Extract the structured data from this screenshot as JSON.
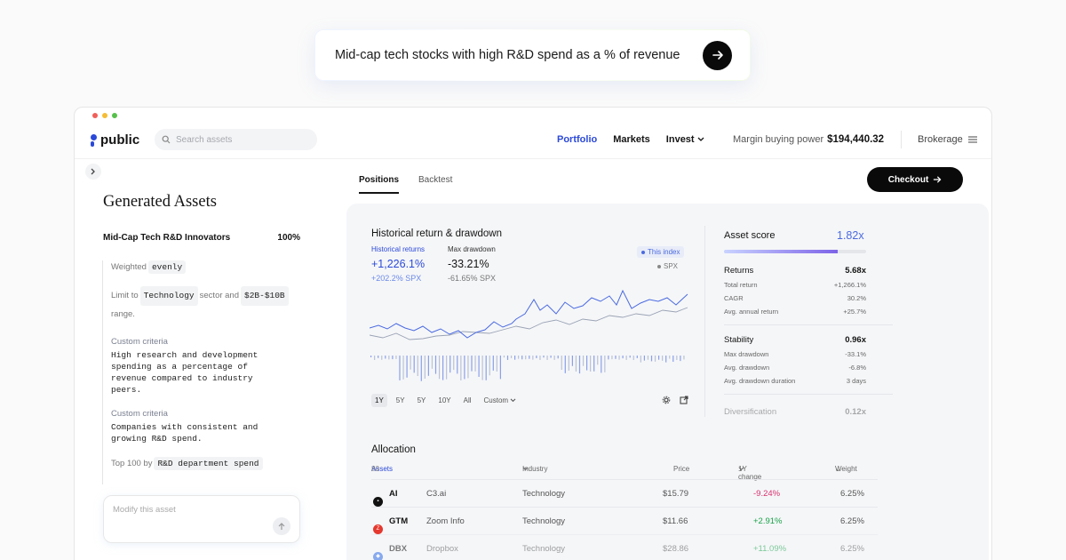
{
  "prompt": {
    "text": "Mid-cap tech stocks with high R&D spend as a % of revenue"
  },
  "window": {
    "dot_colors": [
      "#f0605a",
      "#f5bd35",
      "#56c04b"
    ]
  },
  "header": {
    "logo_text": "public",
    "search_placeholder": "Search assets",
    "nav": [
      "Portfolio",
      "Markets",
      "Invest"
    ],
    "margin_label": "Margin buying power",
    "margin_value": "$194,440.32",
    "brokerage": "Brokerage"
  },
  "sidebar": {
    "title": "Generated Assets",
    "asset_name": "Mid-Cap Tech R&D Innovators",
    "asset_pct": "100%",
    "criteria": {
      "weighted_prefix": "Weighted",
      "weighted_value": "evenly",
      "limit_prefix": "Limit to",
      "limit_sector": "Technology",
      "limit_mid": "sector and",
      "limit_range": "$2B-$10B",
      "limit_suffix": "range.",
      "custom1_label": "Custom criteria",
      "custom1_text": "High research and development spending as a percentage of revenue compared to industry peers.",
      "custom2_label": "Custom criteria",
      "custom2_text": "Companies with consistent and growing R&D spend.",
      "top_prefix": "Top 100 by",
      "top_value": "R&D department spend"
    },
    "modify_placeholder": "Modify this asset"
  },
  "tabs": [
    "Positions",
    "Backtest"
  ],
  "checkout_label": "Checkout",
  "history": {
    "title": "Historical return & drawdown",
    "ret_label": "Historical returns",
    "ret_value": "+1,226.1%",
    "ret_sub": "+202.2% SPX",
    "dd_label": "Max drawdown",
    "dd_value": "-33.21%",
    "dd_sub": "-61.65% SPX",
    "legend_index": "This index",
    "legend_spx": "SPX",
    "ranges": [
      "1Y",
      "5Y",
      "5Y",
      "10Y",
      "All",
      "Custom"
    ],
    "index_color": "#4a6ae0",
    "spx_color": "#9aa3b5"
  },
  "score": {
    "title": "Asset score",
    "value": "1.82x",
    "fill_fraction": 0.8,
    "returns": {
      "label": "Returns",
      "value": "5.68x",
      "rows": [
        [
          "Total return",
          "+1,266.1%"
        ],
        [
          "CAGR",
          "30.2%"
        ],
        [
          "Avg. annual return",
          "+25.7%"
        ]
      ]
    },
    "stability": {
      "label": "Stability",
      "value": "0.96x",
      "rows": [
        [
          "Max drawdown",
          "-33.1%"
        ],
        [
          "Avg. drawdown",
          "-6.8%"
        ],
        [
          "Avg. drawdown duration",
          "3 days"
        ]
      ]
    },
    "diversification": {
      "label": "Diversification",
      "value": "0.12x"
    }
  },
  "allocation": {
    "title": "Allocation",
    "headers": {
      "assets": "Assets",
      "assets_count": "80",
      "industry": "Industry",
      "price": "Price",
      "change": "1Y change",
      "weight": "Weight"
    },
    "rows": [
      {
        "ticker": "AI",
        "name": "C3.ai",
        "industry": "Technology",
        "price": "$15.79",
        "change": "-9.24%",
        "weight": "6.25%",
        "icon_color": "#111111",
        "change_color": "#d8326d"
      },
      {
        "ticker": "GTM",
        "name": "Zoom Info",
        "industry": "Technology",
        "price": "$11.66",
        "change": "+2.91%",
        "weight": "6.25%",
        "icon_color": "#e5382e",
        "change_color": "#19a34a"
      },
      {
        "ticker": "DBX",
        "name": "Dropbox",
        "industry": "Technology",
        "price": "$28.86",
        "change": "+11.09%",
        "weight": "6.25%",
        "icon_color": "#2f6be6",
        "change_color": "#19a34a"
      }
    ]
  }
}
